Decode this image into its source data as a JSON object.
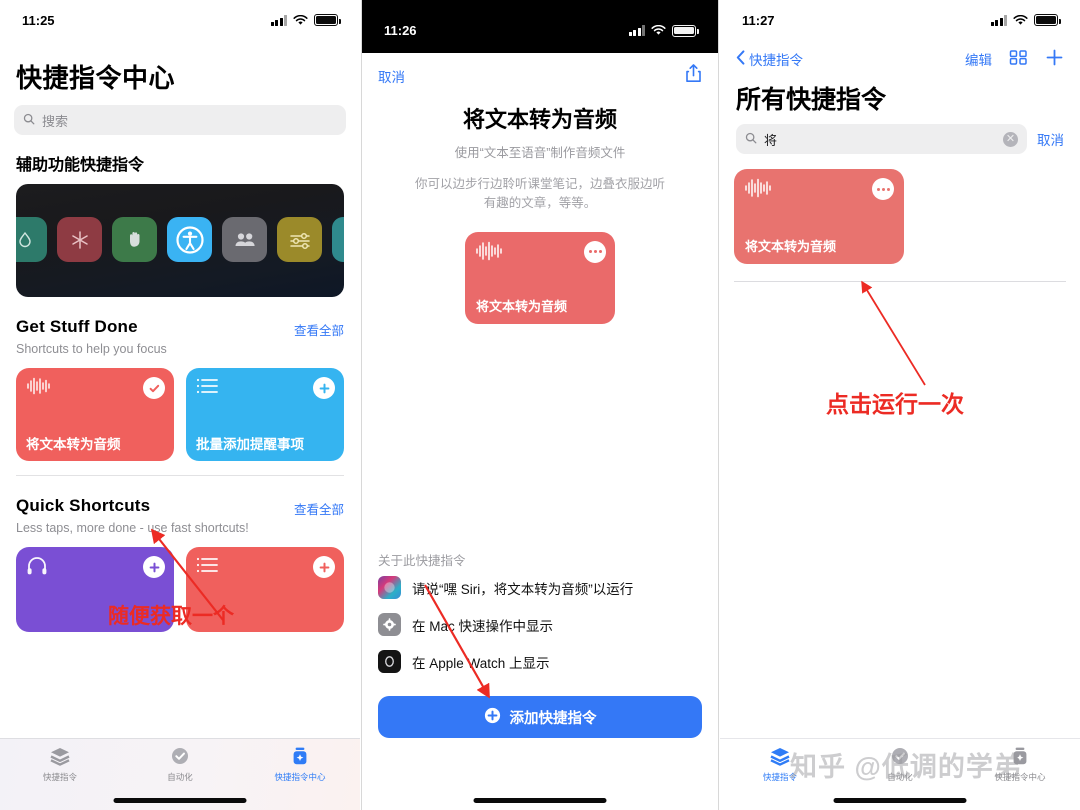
{
  "panel1": {
    "status": {
      "time": "11:25"
    },
    "title": "快捷指令中心",
    "search": {
      "placeholder": "搜索",
      "icon": "search-icon"
    },
    "section_accessibility": {
      "heading": "辅助功能快捷指令"
    },
    "banner_icons": [
      {
        "name": "droplet-icon",
        "color": "#2d7a6a"
      },
      {
        "name": "asterisk-icon",
        "color": "#8e3b43"
      },
      {
        "name": "hand-icon",
        "color": "#3d7a49"
      },
      {
        "name": "accessibility-icon",
        "color": "#3ab3f3"
      },
      {
        "name": "people-icon",
        "color": "#6a6a70"
      },
      {
        "name": "sliders-icon",
        "color": "#9b8a2a"
      },
      {
        "name": "sparkle-icon",
        "color": "#2f8a8d"
      }
    ],
    "section_get_stuff_done": {
      "title": "Get Stuff Done",
      "see_all": "查看全部",
      "subtitle": "Shortcuts to help you focus",
      "cards": [
        {
          "label": "将文本转为音频",
          "color": "#f0605d",
          "glyph": "waveform-icon",
          "badge": "check-icon"
        },
        {
          "label": "批量添加提醒事项",
          "color": "#35b4f0",
          "glyph": "list-icon",
          "badge": "plus-icon"
        }
      ]
    },
    "section_quick_shortcuts": {
      "title": "Quick Shortcuts",
      "see_all": "查看全部",
      "subtitle": "Less taps, more done - use fast shortcuts!",
      "cards": [
        {
          "label": "",
          "color": "#7a4fd4",
          "glyph": "headphones-icon",
          "badge": "plus-icon"
        },
        {
          "label": "",
          "color": "#f0605d",
          "glyph": "list-icon",
          "badge": "plus-icon"
        }
      ]
    },
    "tabs": [
      {
        "label": "快捷指令",
        "icon": "stack-icon",
        "active": false
      },
      {
        "label": "自动化",
        "icon": "automation-clock-icon",
        "active": false
      },
      {
        "label": "快捷指令中心",
        "icon": "gallery-jar-icon",
        "active": true
      }
    ],
    "annotation": {
      "text": "随便获取一个",
      "color": "#ec2b24"
    }
  },
  "panel2": {
    "status": {
      "time": "11:26"
    },
    "cancel": "取消",
    "share_icon": "share-icon",
    "title": "将文本转为音频",
    "subtitle": "使用“文本至语音”制作音频文件",
    "description": "你可以边步行边聆听课堂笔记，边叠衣服边听有趣的文章，等等。",
    "card": {
      "label": "将文本转为音频",
      "color": "#ea6a6a",
      "glyph": "waveform-icon",
      "badge": "more-dots-icon"
    },
    "about_heading": "关于此快捷指令",
    "about_items": [
      {
        "text": "请说“嘿 Siri，将文本转为音频”以运行",
        "icon": "siri-icon"
      },
      {
        "text": "在 Mac 快速操作中显示",
        "icon": "gear-icon"
      },
      {
        "text": "在 Apple Watch 上显示",
        "icon": "apple-watch-icon"
      }
    ],
    "add_button": {
      "label": "添加快捷指令",
      "icon": "plus-circle-icon",
      "color": "#3478f6"
    }
  },
  "panel3": {
    "status": {
      "time": "11:27"
    },
    "back_label": "快捷指令",
    "edit_label": "编辑",
    "grid_icon": "grid-icon",
    "add_icon": "plus-icon",
    "title": "所有快捷指令",
    "search": {
      "value": "将",
      "icon": "search-icon",
      "clear_icon": "clear-icon"
    },
    "cancel": "取消",
    "result_card": {
      "label": "将文本转为音频",
      "color": "#e8736f",
      "glyph": "waveform-icon",
      "badge": "more-dots-icon"
    },
    "tabs": [
      {
        "label": "快捷指令",
        "icon": "stack-icon",
        "active": true
      },
      {
        "label": "自动化",
        "icon": "automation-clock-icon",
        "active": false
      },
      {
        "label": "快捷指令中心",
        "icon": "gallery-jar-icon",
        "active": false
      }
    ],
    "annotation": {
      "text": "点击运行一次",
      "color": "#ec2b24"
    }
  },
  "watermark": {
    "text": "知乎 @低调的学弟"
  }
}
